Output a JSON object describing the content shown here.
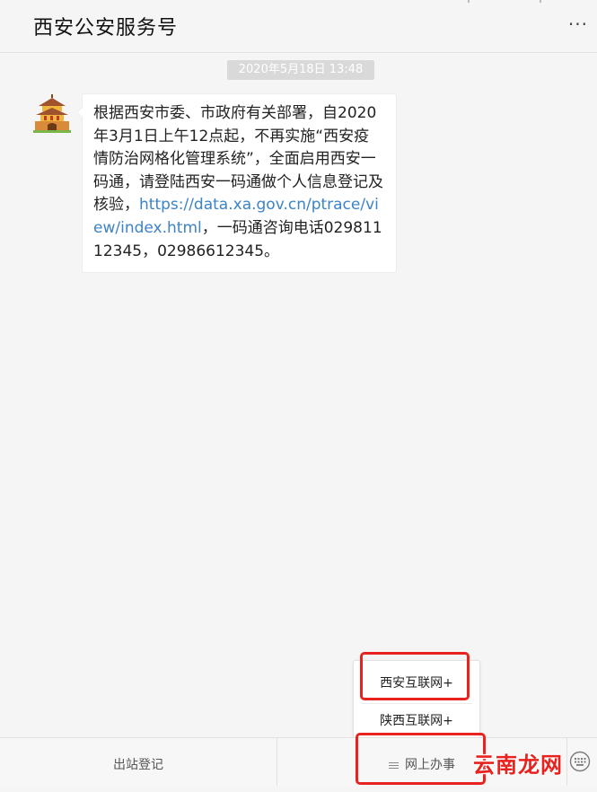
{
  "header": {
    "title": "西安公安服务号",
    "more_glyph": "···"
  },
  "timestamp": "2020年5月18日 13:48",
  "message": {
    "text_before": "根据西安市委、市政府有关部署，自2020年3月1日上午12点起，不再实施“西安疫情防治网格化管理系统”，全面启用西安一码通，请登陆西安一码通做个人信息登记及核验，",
    "link": "https://data.xa.gov.cn/ptrace/view/index.html",
    "text_after": "，一码通咨询电话02981112345，02986612345。"
  },
  "popup_menu": {
    "items": [
      "西安互联网+",
      "陕西互联网+"
    ]
  },
  "bottom_menu": {
    "left_label": "出站登记",
    "right_label": "网上办事"
  },
  "watermark": "云南龙网",
  "colors": {
    "highlight": "#e8231f",
    "link": "#3c83c7"
  },
  "icons": [
    "more-icon",
    "avatar-icon",
    "menu-lines-icon",
    "keyboard-icon"
  ]
}
